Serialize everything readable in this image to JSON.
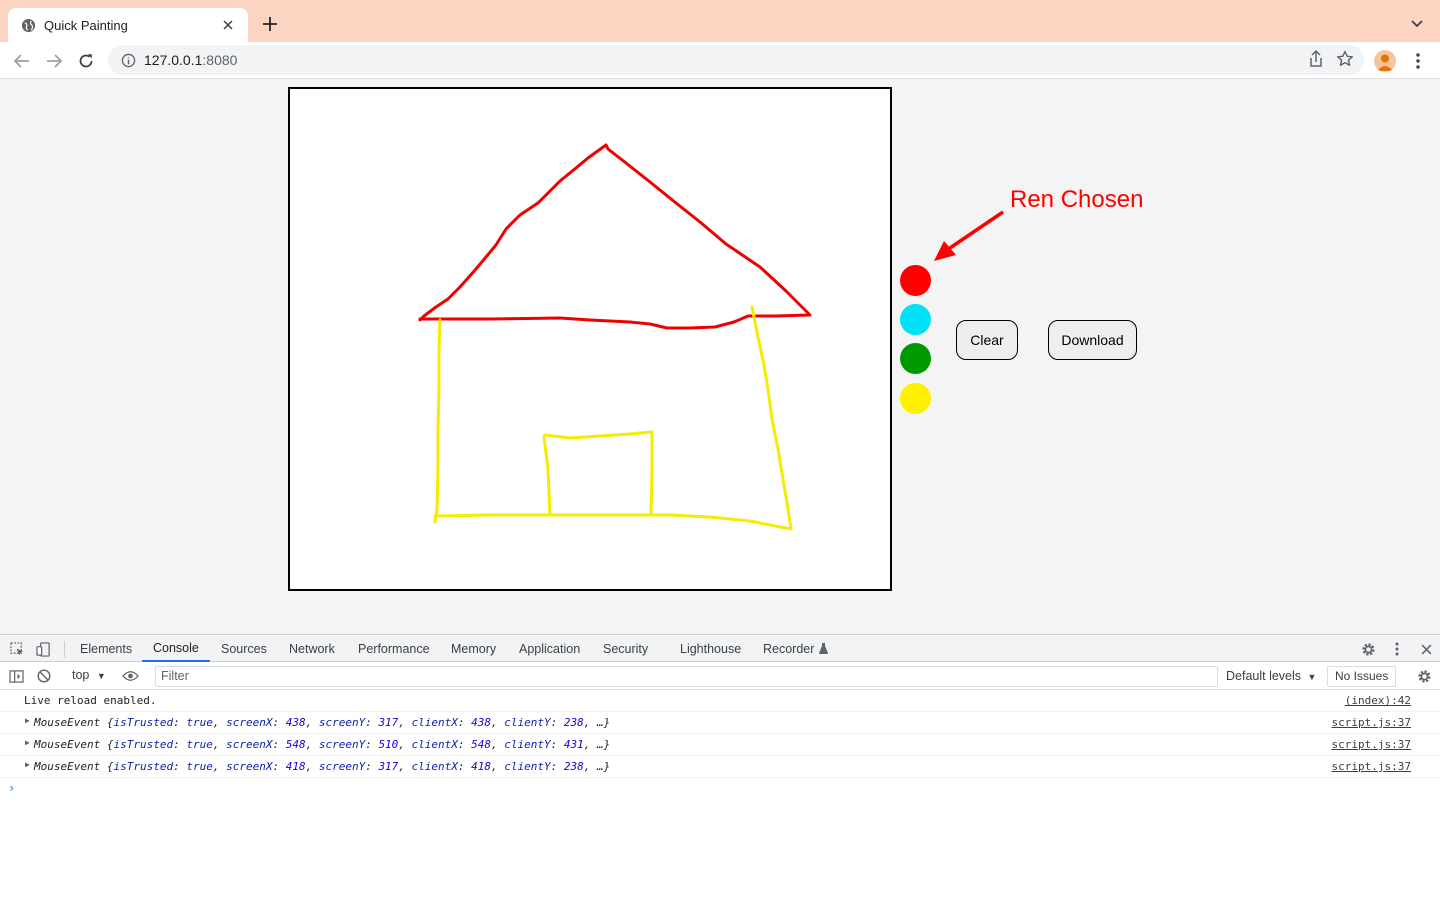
{
  "browser": {
    "tab_title": "Quick Painting",
    "url_host": "127.0.0.1",
    "url_port": ":8080"
  },
  "page": {
    "annotation": "Ren Chosen",
    "colors": [
      "#ff0000",
      "#00e1f5",
      "#009a00",
      "#fff000"
    ],
    "clear_label": "Clear",
    "download_label": "Download",
    "stroke_colors": {
      "roof": "#ee0000",
      "walls": "#f5ec00"
    }
  },
  "devtools": {
    "tabs": [
      "Elements",
      "Console",
      "Sources",
      "Network",
      "Performance",
      "Memory",
      "Application",
      "Security",
      "Lighthouse",
      "Recorder"
    ],
    "active_tab": "Console",
    "context": "top",
    "filter_placeholder": "Filter",
    "levels": "Default levels",
    "issues": "No Issues",
    "logs": [
      {
        "text": "Live reload enabled.",
        "source": "(index):42"
      },
      {
        "type": "MouseEvent",
        "isTrusted": "true",
        "screenX": "438",
        "screenY": "317",
        "clientX": "438",
        "clientY": "238",
        "source": "script.js:37"
      },
      {
        "type": "MouseEvent",
        "isTrusted": "true",
        "screenX": "548",
        "screenY": "510",
        "clientX": "548",
        "clientY": "431",
        "source": "script.js:37"
      },
      {
        "type": "MouseEvent",
        "isTrusted": "true",
        "screenX": "418",
        "screenY": "317",
        "clientX": "418",
        "clientY": "238",
        "source": "script.js:37"
      }
    ]
  }
}
